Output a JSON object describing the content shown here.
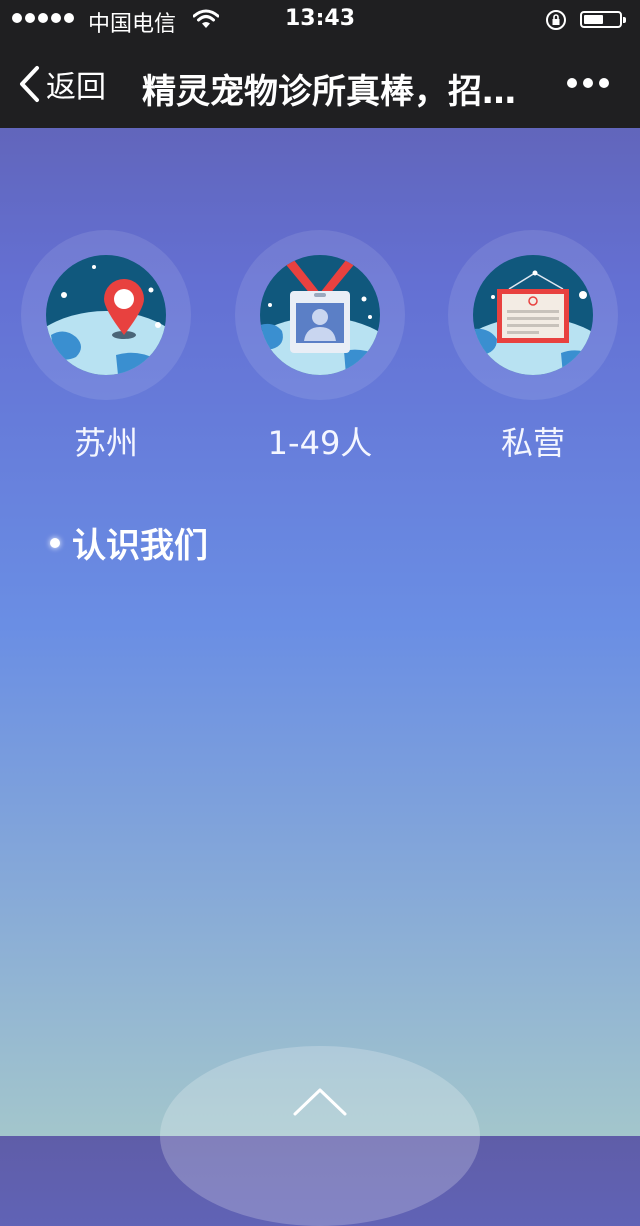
{
  "status_bar": {
    "carrier": "中国电信",
    "time": "13:43",
    "signal_icon": "signal-dots-icon",
    "wifi_icon": "wifi-icon",
    "lock_icon": "rotation-lock-icon",
    "battery_icon": "battery-icon",
    "battery_level": 0.55
  },
  "nav": {
    "back_label": "返回",
    "title": "精灵宠物诊所真棒，招…",
    "more_icon": "more-dots-icon"
  },
  "features": [
    {
      "label": "苏州",
      "icon": "location-pin-globe-icon"
    },
    {
      "label": "1-49人",
      "icon": "id-badge-globe-icon"
    },
    {
      "label": "私营",
      "icon": "signboard-globe-icon"
    }
  ],
  "section": {
    "title": "认识我们"
  },
  "colors": {
    "bar_bg": "#1f1f21",
    "bg_top": "#5f5da8",
    "bg_mid": "#6a8ee4",
    "bg_bottom": "#a3c6cc",
    "globe_ocean": "#10587d",
    "globe_land": "#b8e2f2",
    "pin_red": "#e8413f"
  },
  "scroll_up_icon": "chevron-up-icon"
}
